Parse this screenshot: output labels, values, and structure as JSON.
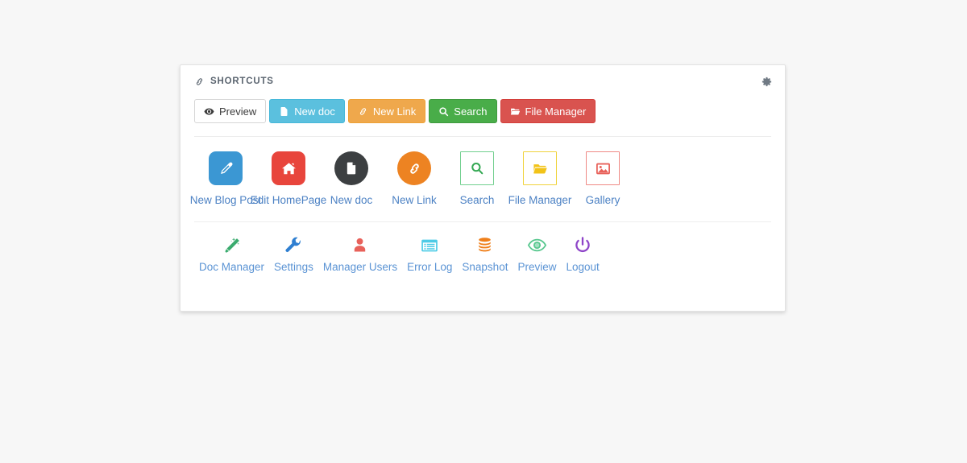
{
  "card": {
    "header": {
      "icon": "chain-link-icon",
      "title": "SHORTCUTS",
      "settings_icon": "gear-icon"
    }
  },
  "buttons": [
    {
      "label": "Preview",
      "icon": "eye-icon",
      "style": "default",
      "bg": "#ffffff",
      "fg": "#3b3b3b"
    },
    {
      "label": "New doc",
      "icon": "document-icon",
      "style": "info",
      "bg": "#5bc0de",
      "fg": "#ffffff"
    },
    {
      "label": "New Link",
      "icon": "chain-link-icon",
      "style": "warning",
      "bg": "#efa84c",
      "fg": "#ffffff"
    },
    {
      "label": "Search",
      "icon": "magnifier-icon",
      "style": "success",
      "bg": "#49ad49",
      "fg": "#ffffff"
    },
    {
      "label": "File Manager",
      "icon": "open-folder-icon",
      "style": "danger",
      "bg": "#d9534f",
      "fg": "#ffffff"
    }
  ],
  "tiles": [
    {
      "label": "New Blog Post",
      "icon": "pencil-icon",
      "shape": "rounded",
      "bg": "#3b97d3",
      "fg": "#ffffff",
      "border": ""
    },
    {
      "label": "Edit HomePage",
      "icon": "home-icon",
      "shape": "rounded",
      "bg": "#e8453c",
      "fg": "#ffffff",
      "border": ""
    },
    {
      "label": "New doc",
      "icon": "document-icon",
      "shape": "circle",
      "bg": "#3c3f41",
      "fg": "#ffffff",
      "border": ""
    },
    {
      "label": "New Link",
      "icon": "chain-link-icon",
      "shape": "circle",
      "bg": "#ed8322",
      "fg": "#ffffff",
      "border": ""
    },
    {
      "label": "Search",
      "icon": "magnifier-icon",
      "shape": "outline",
      "bg": "#ffffff",
      "fg": "#34a853",
      "border": "#71cf8e"
    },
    {
      "label": "File Manager",
      "icon": "open-folder-icon",
      "shape": "outline",
      "bg": "#ffffff",
      "fg": "#f2c318",
      "border": "#f0d33c"
    },
    {
      "label": "Gallery",
      "icon": "image-icon",
      "shape": "outline",
      "bg": "#ffffff",
      "fg": "#e8615a",
      "border": "#ef8a85"
    }
  ],
  "mini_items": [
    {
      "label": "Doc Manager",
      "icon": "magic-wand-icon",
      "fg": "#3aab6e"
    },
    {
      "label": "Settings",
      "icon": "wrench-icon",
      "fg": "#2f7fd1"
    },
    {
      "label": "Manager Users",
      "icon": "user-icon",
      "fg": "#e8615a"
    },
    {
      "label": "Error Log",
      "icon": "list-table-icon",
      "fg": "#4ecbe6"
    },
    {
      "label": "Snapshot",
      "icon": "database-icon",
      "fg": "#ef7f1a"
    },
    {
      "label": "Preview",
      "icon": "eye-icon",
      "fg": "#57c78e"
    },
    {
      "label": "Logout",
      "icon": "power-icon",
      "fg": "#8e44c8"
    }
  ],
  "colors": {
    "page_bg": "#f7f7f7",
    "card_bg": "#ffffff",
    "card_border": "#e3e3e3",
    "divider": "#ededed",
    "tile_label": "#4d82c4",
    "mini_label": "#5a93d4",
    "header_text": "#5b6570"
  }
}
